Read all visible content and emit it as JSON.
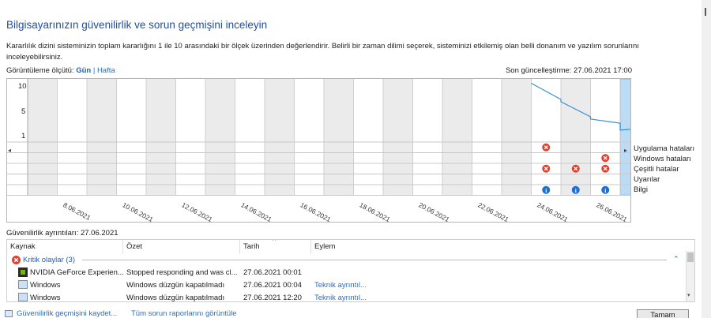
{
  "title": "Bilgisayarınızın güvenilirlik ve sorun geçmişini inceleyin",
  "description": "Kararlılık dizini sisteminizin toplam kararlığını 1 ile 10 arasındaki bir ölçek üzerinden değerlendirir. Belirli bir zaman dilimi seçerek, sisteminizi etkilemiş olan belli donanım ve yazılım sorunlarını inceleyebilirsiniz.",
  "view_by": {
    "label": "Görüntüleme ölçütü:",
    "day": "Gün",
    "separator": "|",
    "week": "Hafta"
  },
  "last_updated": "Son güncelleştirme: 27.06.2021 17:00",
  "chart": {
    "y_ticks": [
      "10",
      "5",
      "1"
    ],
    "row_labels": [
      "Uygulama hataları",
      "Windows hataları",
      "Çeşitli hatalar",
      "Uyarılar",
      "Bilgi"
    ],
    "dates": [
      "8.06.2021",
      "10.06.2021",
      "12.06.2021",
      "14.06.2021",
      "16.06.2021",
      "18.06.2021",
      "20.06.2021",
      "22.06.2021",
      "24.06.2021",
      "26.06.2021"
    ]
  },
  "chart_data": {
    "type": "line",
    "y_range": [
      1,
      10
    ],
    "x_start": "7.06.2021",
    "x_end": "27.06.2021",
    "stability_index": [
      {
        "x": "24.06.2021",
        "y": 9.8
      },
      {
        "x": "24.06.2021",
        "y": 7.0
      },
      {
        "x": "25.06.2021",
        "y": 6.6
      },
      {
        "x": "25.06.2021",
        "y": 4.0
      },
      {
        "x": "26.06.2021",
        "y": 3.6
      },
      {
        "x": "26.06.2021",
        "y": 2.9
      },
      {
        "x": "27.06.2021",
        "y": 1.7
      },
      {
        "x": "27.06.2021",
        "y": 2.1
      }
    ],
    "events": {
      "app_failures": [
        "24.06.2021",
        "27.06.2021"
      ],
      "windows_failures": [
        "26.06.2021"
      ],
      "misc_failures": [
        "24.06.2021",
        "25.06.2021",
        "26.06.2021",
        "27.06.2021"
      ],
      "warnings": [
        "27.06.2021"
      ],
      "information": [
        "24.06.2021",
        "25.06.2021",
        "26.06.2021",
        "27.06.2021"
      ]
    },
    "selected": "27.06.2021"
  },
  "details": {
    "title": "Güvenilirlik ayrıntıları: 27.06.2021",
    "columns": [
      "Kaynak",
      "Özet",
      "Tarih",
      "Eylem"
    ],
    "group": "Kritik olaylar (3)",
    "rows": [
      {
        "source": "NVIDIA GeForce Experien...",
        "summary": "Stopped responding and was cl...",
        "date": "27.06.2021 00:01",
        "action": "",
        "icon": "nvidia-icon"
      },
      {
        "source": "Windows",
        "summary": "Windows düzgün kapatılmadı",
        "date": "27.06.2021 00:04",
        "action": "Teknik ayrıntıl...",
        "icon": "windows-icon"
      },
      {
        "source": "Windows",
        "summary": "Windows düzgün kapatılmadı",
        "date": "27.06.2021 12:20",
        "action": "Teknik ayrıntıl...",
        "icon": "windows-icon"
      }
    ]
  },
  "bottom": {
    "save_link": "Güvenilirlik geçmişini kaydet...",
    "all_reports_link": "Tüm sorun raporlarını görüntüle",
    "ok_button": "Tamam"
  },
  "colors": {
    "title": "#1f4e9a",
    "link": "#1f6fd0",
    "selected_col": "#bcdcf5",
    "line": "#3a8fd8",
    "error": "#e0412f",
    "info": "#1f6fd0",
    "warning": "#f3c300"
  }
}
